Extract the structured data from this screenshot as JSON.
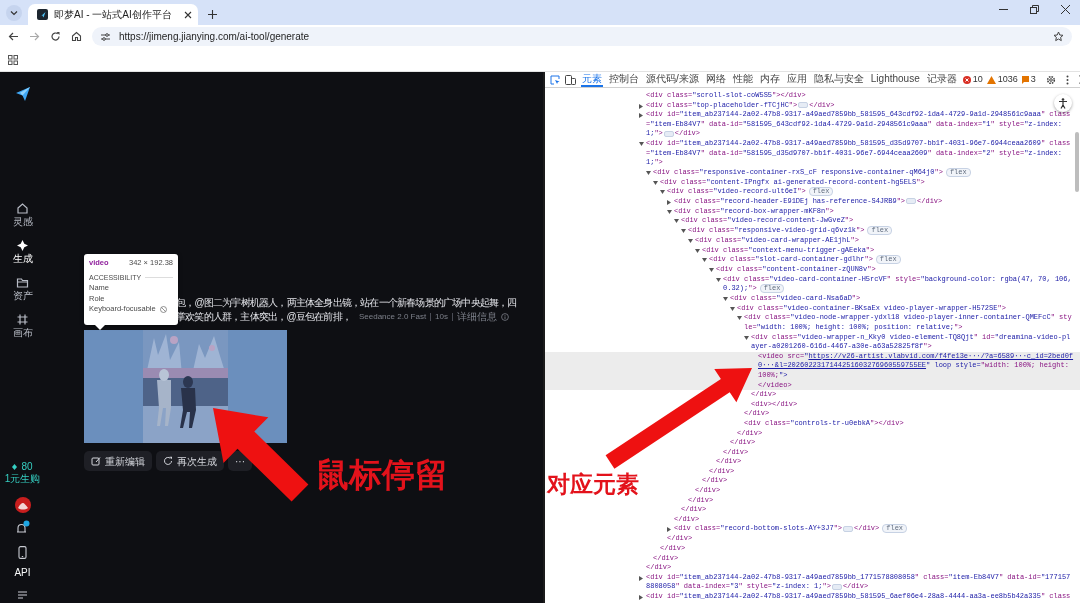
{
  "browser": {
    "tab": {
      "title": "即梦AI - 一站式AI创作平台"
    },
    "address": "https://jimeng.jianying.com/ai-tool/generate"
  },
  "app": {
    "sidebar": {
      "items": [
        {
          "kind": "home",
          "label": "灵感",
          "selected": false
        },
        {
          "kind": "generate",
          "label": "生成",
          "selected": true
        },
        {
          "kind": "assets",
          "label": "资产",
          "selected": false
        },
        {
          "kind": "canvas",
          "label": "画布",
          "selected": false
        }
      ],
      "credits": "80",
      "promo": "1元生购",
      "api": "API"
    },
    "record": {
      "prompt_lines": [
        "包，@图二为宇树机器人，两主体全身出镜，站在一个新春场景的广场中央起舞，四",
        "掌欢笑的人群，主体突出，@豆包在前排，"
      ],
      "model": "Seedance 2.0 Fast",
      "duration": "10s",
      "details": "详细信息",
      "video": {
        "kind": "picture"
      },
      "actions": [
        {
          "kind": "edit",
          "label": "重新编辑"
        },
        {
          "kind": "regenerate",
          "label": "再次生成"
        },
        {
          "kind": "more",
          "label": "···"
        }
      ]
    },
    "inspect_tooltip": {
      "tag": "video",
      "size": "342 × 192.38",
      "section": "ACCESSIBILITY",
      "rows": [
        {
          "label": "Name"
        },
        {
          "label": "Role"
        },
        {
          "label": "Keyboard-focusable",
          "kind": "blocked"
        }
      ]
    }
  },
  "devtools": {
    "tabs": [
      {
        "label": "元素",
        "selected": true
      },
      {
        "label": "控制台",
        "selected": false
      },
      {
        "label": "源代码/来源",
        "selected": false
      },
      {
        "label": "网络",
        "selected": false
      },
      {
        "label": "性能",
        "selected": false
      },
      {
        "label": "内存",
        "selected": false
      },
      {
        "label": "应用",
        "selected": false
      },
      {
        "label": "隐私与安全",
        "selected": false
      },
      {
        "label": "Lighthouse",
        "selected": false
      },
      {
        "label": "记录器",
        "selected": false
      }
    ],
    "errors": "10",
    "warnings": "1036",
    "issues": "3",
    "dom": [
      {
        "kind": "inline",
        "selected": false,
        "open": "<div class=\"scroll-slot-coW5S5\">",
        "close": "</div>"
      },
      {
        "kind": "collapsed",
        "selected": false,
        "open": "<div class=\"top-placeholder-fTCjHC\">",
        "close": "</div>"
      },
      {
        "kind": "collapsed",
        "selected": false,
        "open": "<div id=\"item_ab237144-2a02-47b8-9317-a49aed7859bb_581595_643cdf92-1da4-4729-9a1d-2948561c9aaa\" class=\"item-Eb84V7\" data-id=\"581595_643cdf92-1da4-4729-9a1d-2948561c9aaa\" data-index=\"1\" style=\"z-index: 1;\">",
        "close": "</div>"
      },
      {
        "kind": "expanded",
        "selected": false,
        "open": "<div id=\"item_ab237144-2a02-47b8-9317-a49aed7859bb_581595_d35d9707-bb1f-4031-96e7-6944ceaa2609\" class=\"item-Eb84V7\" data-id=\"581595_d35d9707-bb1f-4031-96e7-6944ceaa2609\" data-index=\"2\" style=\"z-index: 1;\">",
        "close": "</div>",
        "children": [
          {
            "kind": "expanded",
            "selected": false,
            "open": "<div class=\"responsive-container-rxS_cF responsive-container-qM64j0\">",
            "badge": "flex",
            "close": "</div>",
            "children": [
              {
                "kind": "expanded",
                "selected": false,
                "open": "<div class=\"content-IPngfx ai-generated-record-content-hg5ELS\">",
                "close": "</div>",
                "children": [
                  {
                    "kind": "expanded",
                    "selected": false,
                    "open": "<div class=\"video-record-ult6eI\">",
                    "badge": "flex",
                    "close": "</div>",
                    "children": [
                      {
                        "kind": "collapsed",
                        "selected": false,
                        "open": "<div class=\"record-header-E91DEj has-reference-S4JRB9\">",
                        "close": "</div>"
                      },
                      {
                        "kind": "expanded",
                        "selected": false,
                        "open": "<div class=\"record-box-wrapper-mKF8n\">",
                        "close": "</div>",
                        "children": [
                          {
                            "kind": "expanded",
                            "selected": false,
                            "open": "<div class=\"video-record-content-JwGveZ\">",
                            "close": "</div>",
                            "children": [
                              {
                                "kind": "expanded",
                                "selected": false,
                                "open": "<div class=\"responsive-video-grid-q6vz1k\">",
                                "badge": "flex",
                                "close": "</div>",
                                "children": [
                                  {
                                    "kind": "expanded",
                                    "selected": false,
                                    "open": "<div class=\"video-card-wrapper-AE1jhL\">",
                                    "close": "</div>",
                                    "children": [
                                      {
                                        "kind": "expanded",
                                        "selected": false,
                                        "open": "<div class=\"context-menu-trigger-gAEeka\">",
                                        "close": "</div>",
                                        "children": [
                                          {
                                            "kind": "expanded",
                                            "selected": false,
                                            "open": "<div class=\"slot-card-container-gdlhr\">",
                                            "badge": "flex",
                                            "close": "</div>",
                                            "children": [
                                              {
                                                "kind": "expanded",
                                                "selected": false,
                                                "open": "<div class=\"content-container-zQUN8v\">",
                                                "close": "</div>",
                                                "children": [
                                                  {
                                                    "kind": "expanded",
                                                    "selected": false,
                                                    "open": "<div class=\"video-card-container-H5rcVF\" style=\"background-color: rgba(47, 70, 106, 0.32);\">",
                                                    "badge": "flex",
                                                    "close": "</div>",
                                                    "children": [
                                                      {
                                                        "kind": "expanded",
                                                        "selected": false,
                                                        "open": "<div class=\"video-card-Nsa6aD\">",
                                                        "close": "</div>",
                                                        "children": [
                                                          {
                                                            "kind": "expanded",
                                                            "selected": false,
                                                            "open": "<div class=\"video-container-BKsaEx video-player-wrapper-H572SE\">",
                                                            "close": "</div>",
                                                            "children": [
                                                              {
                                                                "kind": "expanded",
                                                                "selected": false,
                                                                "open": "<div class=\"video-node-wrapper-ydxl18 video-player-inner-container-QMEFcC\" style=\"width: 100%; height: 100%; position: relative;\">",
                                                                "close": "</div>",
                                                                "children": [
                                                                  {
                                                                    "kind": "expanded",
                                                                    "selected": false,
                                                                    "open": "<div class=\"video-wrapper-n_Kky0 video-element-TQ8Qjt\" id=\"dreamina-video-player-a0201260-616d-4467-a30e-a63a52825f8f\">",
                                                                    "close": "</div>",
                                                                    "children": [
                                                                      {
                                                                        "kind": "block",
                                                                        "selected": true,
                                                                        "open": "<video src=\"",
                                                                        "link": "https://v26-artist.vlabvid.com/f4fe13e···/?a=6589···c_id=2bed0f0···&l=2026022317144251603276960559755EE",
                                                                        "open_end": "\" loop style=\"width: 100%; height: 100%;\">",
                                                                        "close": "</video>"
                                                                      }
                                                                    ]
                                                                  },
                                                                  {
                                                                    "kind": "inline",
                                                                    "selected": false,
                                                                    "open": "<div>",
                                                                    "close": "</div>"
                                                                  }
                                                                ]
                                                              },
                                                              {
                                                                "kind": "inline",
                                                                "selected": false,
                                                                "open": "<div class=\"controls-tr-u0ebkA\">",
                                                                "close": "</div>"
                                                              }
                                                            ]
                                                          }
                                                        ]
                                                      }
                                                    ]
                                                  }
                                                ]
                                              }
                                            ]
                                          }
                                        ]
                                      }
                                    ]
                                  }
                                ]
                              }
                            ]
                          }
                        ]
                      },
                      {
                        "kind": "collapsed",
                        "selected": false,
                        "open": "<div class=\"record-bottom-slots-AY+3J7\">",
                        "close": "</div>",
                        "badge": "flex"
                      }
                    ]
                  }
                ]
              }
            ]
          }
        ]
      },
      {
        "kind": "collapsed",
        "selected": false,
        "open": "<div id=\"item_ab237144-2a02-47b8-9317-a49aed7859bb_1771578808058\" class=\"item-Eb84V7\" data-id=\"1771578808058\" data-index=\"3\" style=\"z-index: 1;\">",
        "close": "</div>"
      },
      {
        "kind": "cut",
        "selected": false,
        "open": "<div id=\"item_ab237144-2a02-47b8-9317-a49aed7859bb_581595_6aef06e4-28a8-4444-aa3a-ee8b5b42a335\" class"
      }
    ]
  },
  "annotations": [
    {
      "kind": "arrow-label",
      "text": "鼠标停留"
    },
    {
      "kind": "arrow-label",
      "text": "对应元素"
    }
  ]
}
